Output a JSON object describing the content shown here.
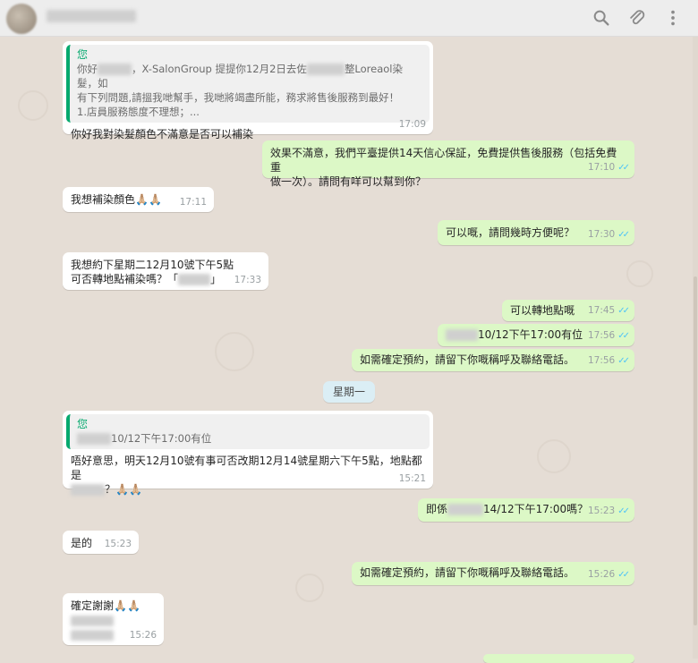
{
  "header": {
    "contact_name": "",
    "icons": [
      "search-icon",
      "paperclip-icon",
      "menu-dots-icon"
    ]
  },
  "colors": {
    "incoming": "#ffffff",
    "outgoing": "#dcf8c6",
    "chat_bg": "#e5ddd5",
    "quote_accent": "#06a96e",
    "read_ticks": "#4fc3f7"
  },
  "date_divider": "星期一",
  "messages": [
    {
      "dir": "in",
      "quote_name": "您",
      "quote_lines": [
        "你好",
        "，X-SalonGroup 提提你12月2日去佐",
        "整Loreaol染髮，如",
        "有下列問題,請搵我哋幫手，我哋將竭盡所能，務求將售後服務到最好！",
        "1.店員服務態度不理想；..."
      ],
      "text": "你好我對染髮顏色不滿意是否可以補染",
      "time": "17:09"
    },
    {
      "dir": "out",
      "text_lines": [
        "效果不滿意，我們平臺提供14天信心保証，免費提供售後服務（包括免費重",
        "做一次）。請問有咩可以幫到你？"
      ],
      "time": "17:10"
    },
    {
      "dir": "in",
      "text": "我想補染顏色🙏🏼🙏🏼",
      "time": "17:11"
    },
    {
      "dir": "out",
      "text": "可以嘅，請問幾時方便呢？",
      "time": "17:30"
    },
    {
      "dir": "in",
      "text_lines": [
        "我想約下星期二12月10號下午5點",
        "可否轉地點補染嗎？「",
        "」"
      ],
      "time": "17:33"
    },
    {
      "dir": "out",
      "text": "可以轉地點嘅",
      "time": "17:45"
    },
    {
      "dir": "out",
      "text": "10/12下午17:00有位",
      "time": "17:56"
    },
    {
      "dir": "out",
      "text": "如需確定預約，請留下你嘅稱呼及聯絡電話。",
      "time": "17:56"
    },
    {
      "dir": "in",
      "quote_name": "您",
      "quote_text": "10/12下午17:00有位",
      "text_lines": [
        "唔好意思，明天12月10號有事可否改期12月14號星期六下午5點，地點都是",
        "？🙏🏼🙏🏼"
      ],
      "time": "15:21"
    },
    {
      "dir": "out",
      "text_parts": [
        "即係",
        "14/12下午17:00嗎？"
      ],
      "time": "15:23"
    },
    {
      "dir": "in",
      "text": "是的",
      "time": "15:23"
    },
    {
      "dir": "out",
      "text": "如需確定預約，請留下你嘅稱呼及聯絡電話。",
      "time": "15:26"
    },
    {
      "dir": "in",
      "text": "確定謝謝🙏🏼🙏🏼",
      "time": "15:26"
    }
  ]
}
